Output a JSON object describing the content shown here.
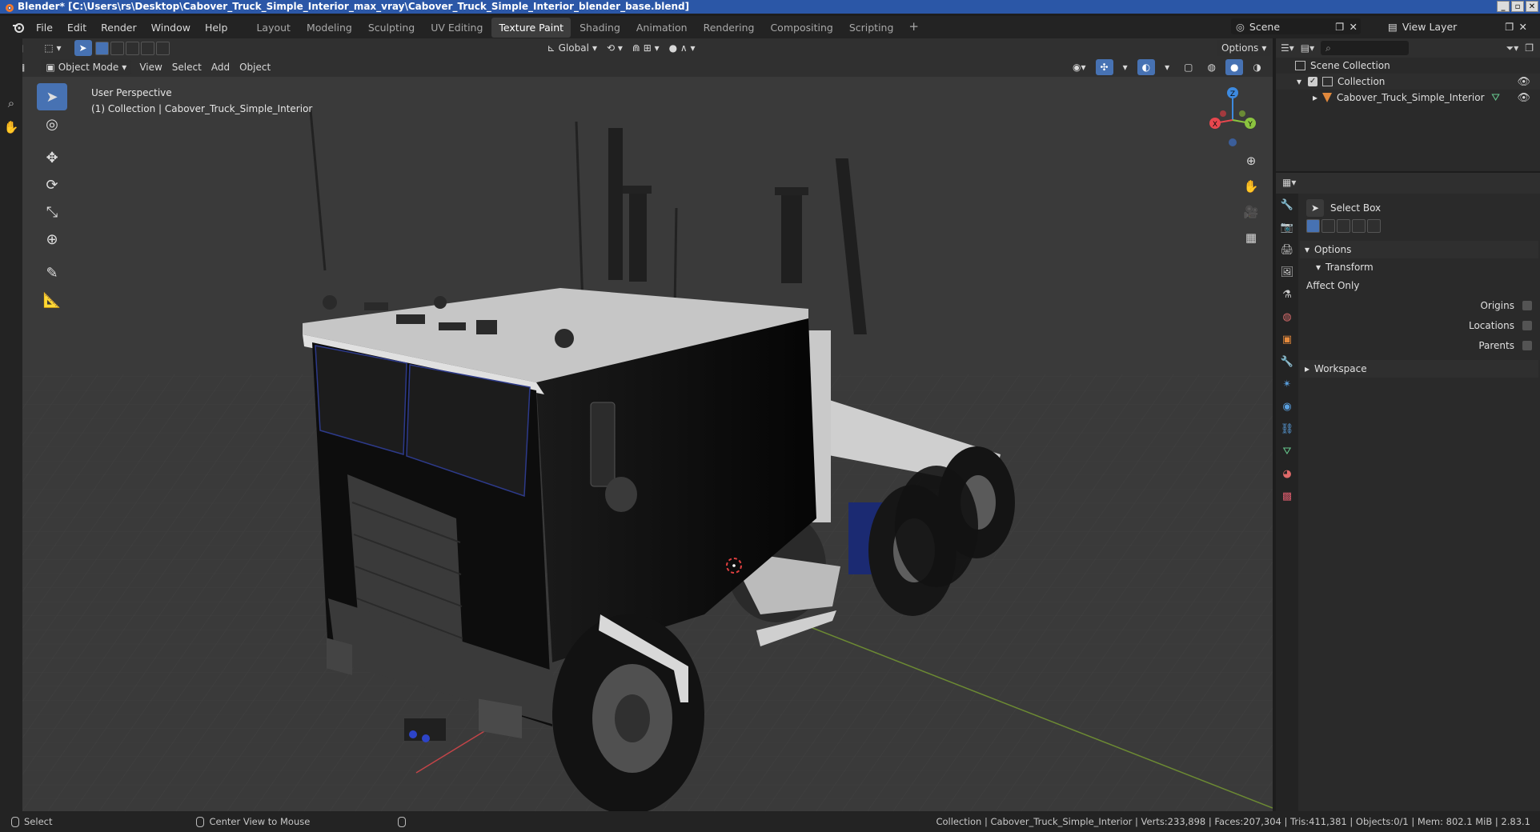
{
  "window": {
    "title": "Blender* [C:\\Users\\rs\\Desktop\\Cabover_Truck_Simple_Interior_max_vray\\Cabover_Truck_Simple_Interior_blender_base.blend]",
    "controls": [
      "_",
      "▫",
      "✕"
    ]
  },
  "menu": [
    "File",
    "Edit",
    "Render",
    "Window",
    "Help"
  ],
  "workspaces": [
    {
      "label": "Layout",
      "active": false
    },
    {
      "label": "Modeling",
      "active": false
    },
    {
      "label": "Sculpting",
      "active": false
    },
    {
      "label": "UV Editing",
      "active": false
    },
    {
      "label": "Texture Paint",
      "active": true
    },
    {
      "label": "Shading",
      "active": false
    },
    {
      "label": "Animation",
      "active": false
    },
    {
      "label": "Rendering",
      "active": false
    },
    {
      "label": "Compositing",
      "active": false
    },
    {
      "label": "Scripting",
      "active": false
    }
  ],
  "scene": {
    "label": "Scene"
  },
  "view_layer": {
    "label": "View Layer"
  },
  "viewport": {
    "mode": "Object Mode",
    "menus": [
      "View",
      "Select",
      "Add",
      "Object"
    ],
    "orientation": "Global",
    "options": "Options",
    "perspective": "User Perspective",
    "collection_info": "(1) Collection | Cabover_Truck_Simple_Interior",
    "gizmo": {
      "x": "X",
      "y": "Y",
      "z": "Z"
    }
  },
  "outliner": {
    "root": "Scene Collection",
    "collection": "Collection",
    "object": "Cabover_Truck_Simple_Interior"
  },
  "properties": {
    "tool_name": "Select Box",
    "options": "Options",
    "transform": "Transform",
    "affect_only": "Affect Only",
    "origins": "Origins",
    "locations": "Locations",
    "parents": "Parents",
    "workspace": "Workspace"
  },
  "status": {
    "left": "Select",
    "middle": "Center View to Mouse",
    "stats": "Collection | Cabover_Truck_Simple_Interior | Verts:233,898 | Faces:207,304 | Tris:411,381 | Objects:0/1 | Mem: 802.1 MiB | 2.83.1"
  },
  "colors": {
    "accent": "#4772b3",
    "title_bar": "#2b57a7",
    "x_axis": "#e8474e",
    "y_axis": "#8bc43f",
    "z_axis": "#3d8ae0"
  }
}
